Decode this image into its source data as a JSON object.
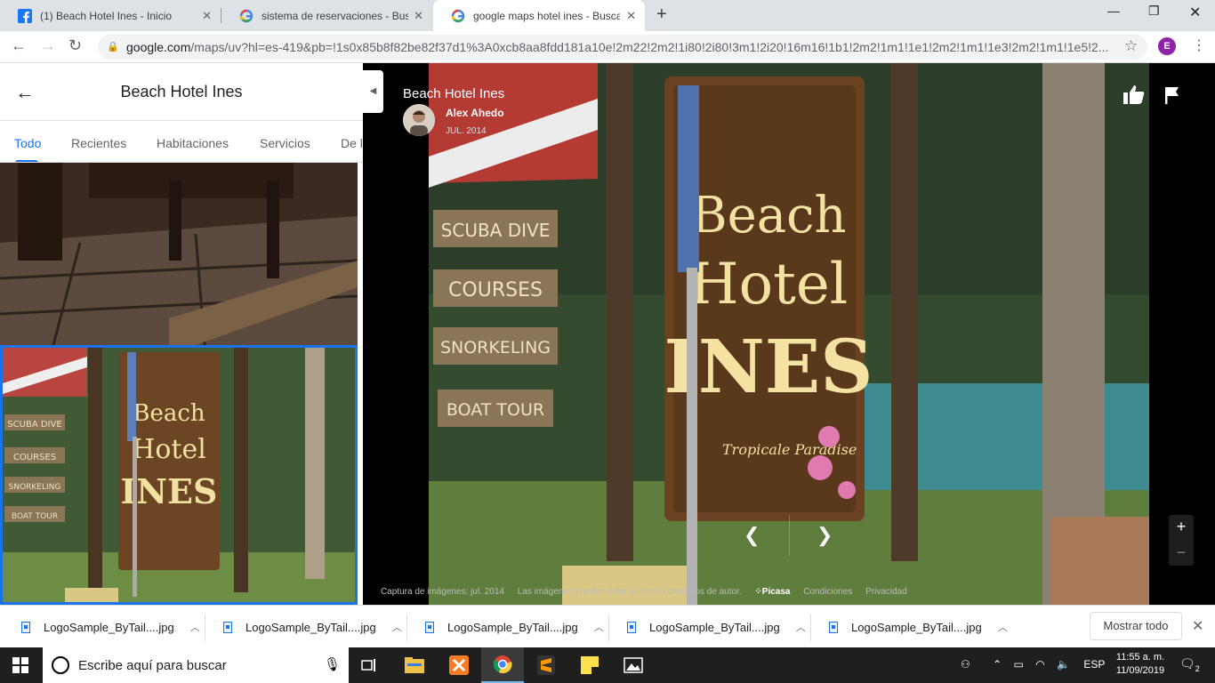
{
  "browser": {
    "tabs": [
      {
        "title": "(1) Beach Hotel Ines - Inicio",
        "icon": "facebook-icon"
      },
      {
        "title": "sistema de reservaciones - Buscar",
        "icon": "google-icon"
      },
      {
        "title": "google maps hotel ines - Buscar",
        "icon": "google-icon"
      }
    ],
    "url_domain": "google.com",
    "url_path": "/maps/uv?hl=es-419&pb=!1s0x85b8f82be82f37d1%3A0xcb8aa8fdd181a10e!2m22!2m2!1i80!2i80!3m1!2i20!16m16!1b1!2m2!1m1!1e1!2m2!1m1!1e3!2m2!1m1!1e5!2...",
    "profile_initial": "E"
  },
  "sidebar": {
    "title": "Beach Hotel Ines",
    "tabs": [
      "Todo",
      "Recientes",
      "Habitaciones",
      "Servicios",
      "De l"
    ]
  },
  "viewer": {
    "title": "Beach Hotel Ines",
    "author": "Alex Ahedo",
    "date": "JUL. 2014",
    "footer": {
      "capture": "Captura de imágenes: jul. 2014",
      "copyright": "Las imágenes pueden estar sujetas a derechos de autor.",
      "source": "Picasa",
      "terms": "Condiciones",
      "privacy": "Privacidad"
    },
    "sign": {
      "board": [
        "SCUBA DIVE",
        "COURSES",
        "SNORKELING",
        "BOAT TOUR"
      ],
      "line1": "Beach",
      "line2": "Hotel",
      "line3": "INES",
      "tagline": "Tropicale Paradise"
    }
  },
  "downloads": {
    "items": [
      "LogoSample_ByTail....jpg",
      "LogoSample_ByTail....jpg",
      "LogoSample_ByTail....jpg",
      "LogoSample_ByTail....jpg",
      "LogoSample_ByTail....jpg"
    ],
    "show_all": "Mostrar todo"
  },
  "taskbar": {
    "search_placeholder": "Escribe aquí para buscar",
    "language": "ESP",
    "time": "11:55 a. m.",
    "date": "11/09/2019",
    "notifications": "2"
  },
  "colors": {
    "accent": "#1a73e8",
    "profile": "#8e24aa"
  }
}
